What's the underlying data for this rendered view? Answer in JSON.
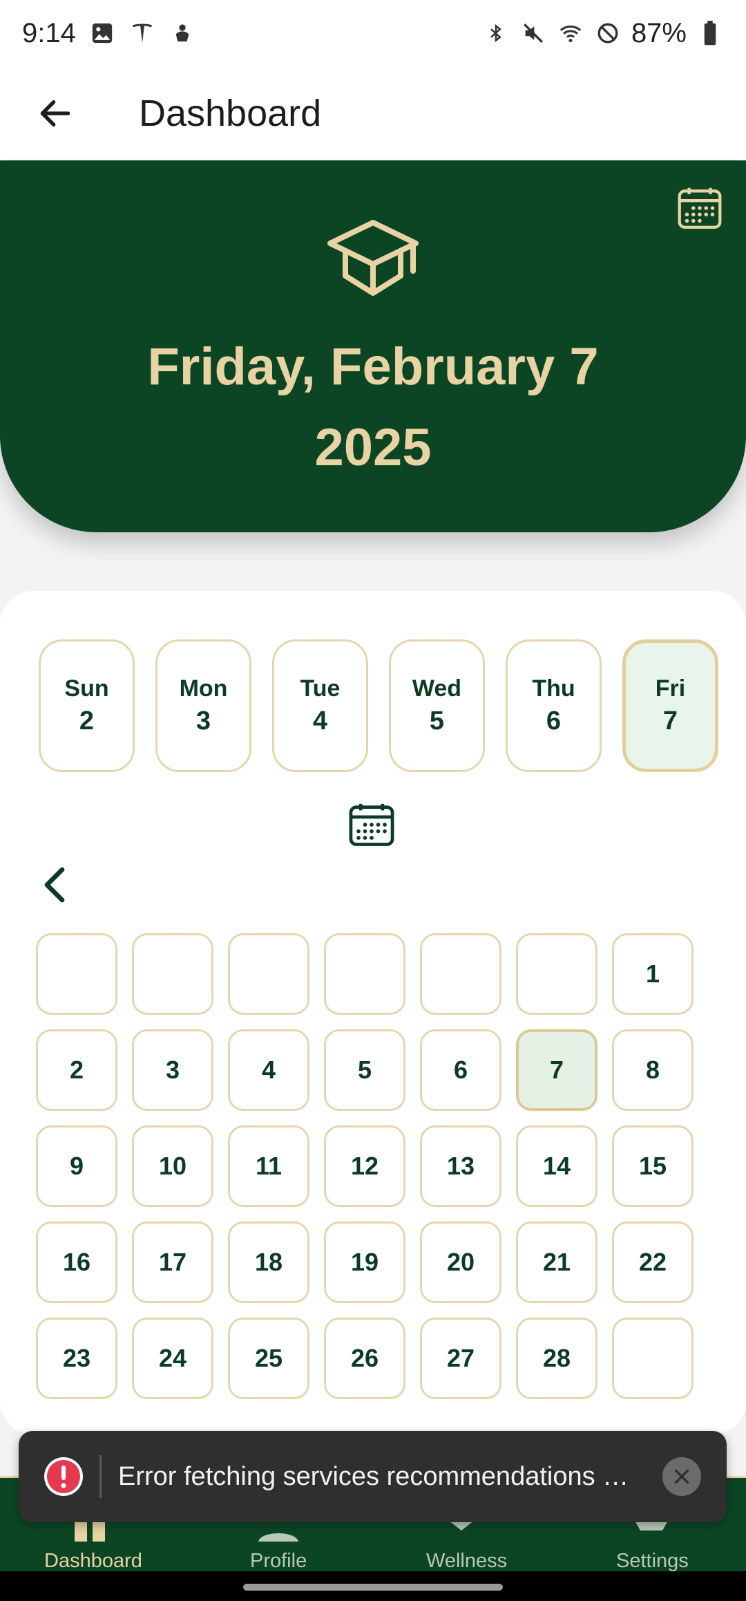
{
  "status_bar": {
    "time": "9:14",
    "battery": "87%",
    "left_icons": [
      "image-icon",
      "tesla-icon",
      "hand-icon"
    ],
    "right_icons": [
      "bluetooth-icon",
      "mute-icon",
      "wifi-icon",
      "do-not-disturb-icon",
      "battery-icon"
    ]
  },
  "app_bar": {
    "title": "Dashboard"
  },
  "hero": {
    "date_line": "Friday, February 7",
    "year": "2025"
  },
  "week": [
    {
      "name": "Sun",
      "num": "2",
      "selected": false
    },
    {
      "name": "Mon",
      "num": "3",
      "selected": false
    },
    {
      "name": "Tue",
      "num": "4",
      "selected": false
    },
    {
      "name": "Wed",
      "num": "5",
      "selected": false
    },
    {
      "name": "Thu",
      "num": "6",
      "selected": false
    },
    {
      "name": "Fri",
      "num": "7",
      "selected": true
    }
  ],
  "month_grid": [
    [
      "",
      "",
      "",
      "",
      "",
      "",
      "1"
    ],
    [
      "2",
      "3",
      "4",
      "5",
      "6",
      "7",
      "8"
    ],
    [
      "9",
      "10",
      "11",
      "12",
      "13",
      "14",
      "15"
    ],
    [
      "16",
      "17",
      "18",
      "19",
      "20",
      "21",
      "22"
    ],
    [
      "23",
      "24",
      "25",
      "26",
      "27",
      "28",
      ""
    ]
  ],
  "selected_day": "7",
  "nav": {
    "items": [
      {
        "label": "Dashboard",
        "active": true
      },
      {
        "label": "Profile",
        "active": false
      },
      {
        "label": "Wellness",
        "active": false
      },
      {
        "label": "Settings",
        "active": false
      }
    ]
  },
  "snackbar": {
    "message": "Error fetching services recommendations …"
  },
  "colors": {
    "primary_green": "#0c4524",
    "gold": "#e8d3a4",
    "cell_border": "#e6d6ae",
    "selected_fill": "#e9f4ea",
    "error_red": "#e53950"
  }
}
